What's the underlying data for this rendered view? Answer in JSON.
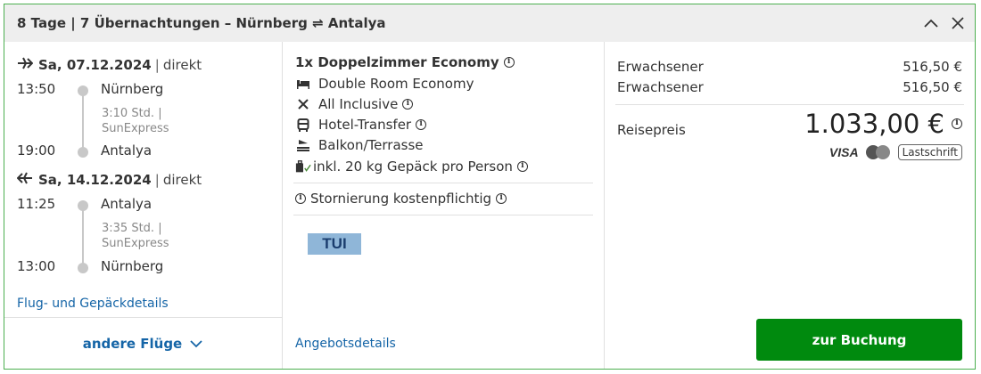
{
  "header": {
    "title": "8 Tage | 7 Übernachtungen – Nürnberg ⇌ Antalya",
    "collapse_icon": "chevron-up-icon",
    "close_icon": "close-icon"
  },
  "flights": {
    "outbound": {
      "date": "Sa, 07.12.2024",
      "separator": "|",
      "type": "direkt",
      "departure_time": "13:50",
      "departure_place": "Nürnberg",
      "duration": "3:10 Std. |",
      "airline": "SunExpress",
      "arrival_time": "19:00",
      "arrival_place": "Antalya"
    },
    "return": {
      "date": "Sa, 14.12.2024",
      "separator": "|",
      "type": "direkt",
      "departure_time": "11:25",
      "departure_place": "Antalya",
      "duration": "3:35 Std. |",
      "airline": "SunExpress",
      "arrival_time": "13:00",
      "arrival_place": "Nürnberg"
    },
    "details_link": "Flug- und Gepäckdetails",
    "more_flights": "andere Flüge"
  },
  "hotel": {
    "room_title": "1x Doppelzimmer Economy",
    "room_type": "Double Room Economy",
    "board": "All Inclusive",
    "transfer": "Hotel-Transfer",
    "balcony": "Balkon/Terrasse",
    "luggage": "inkl. 20 kg Gepäck pro Person",
    "cancellation": "Stornierung kostenpflichtig",
    "operator_logo": "TUI",
    "offer_details": "Angebotsdetails"
  },
  "pricing": {
    "rows": [
      {
        "label": "Erwachsener",
        "value": "516,50 €"
      },
      {
        "label": "Erwachsener",
        "value": "516,50 €"
      }
    ],
    "total_label": "Reisepreis",
    "total_value": "1.033,00 €",
    "payment_visa": "VISA",
    "payment_lastschrift": "Lastschrift",
    "book_button": "zur Buchung"
  },
  "colors": {
    "border": "#4caf50",
    "button": "#008a0e",
    "link": "#1565a7"
  }
}
